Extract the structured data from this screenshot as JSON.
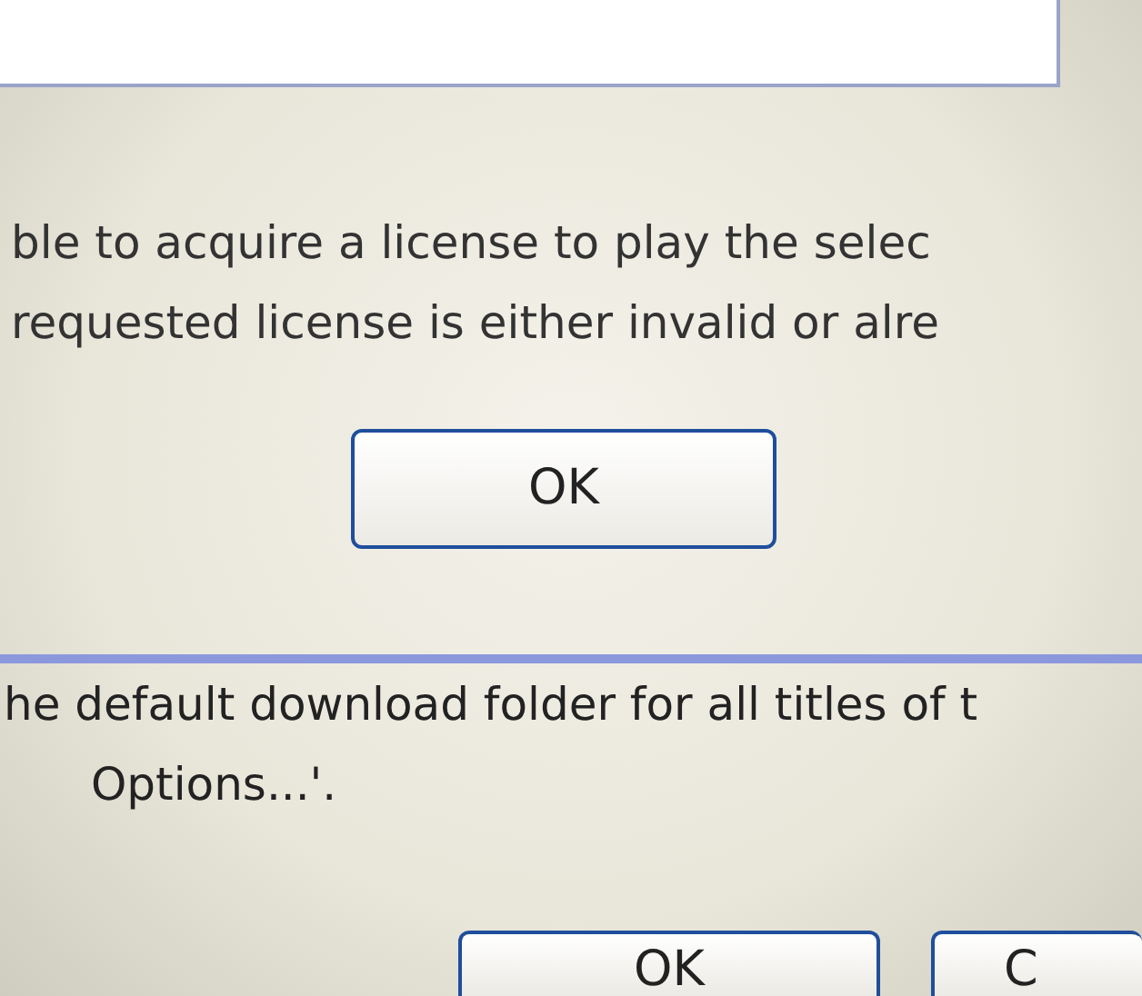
{
  "message": [
    "ble to acquire a license to play the selec",
    "requested license is either invalid or alre"
  ],
  "dialog_button": "OK",
  "background_message": [
    "he default download folder for all titles of t",
    "Options...'."
  ],
  "buttons": [
    "OK",
    "C"
  ]
}
